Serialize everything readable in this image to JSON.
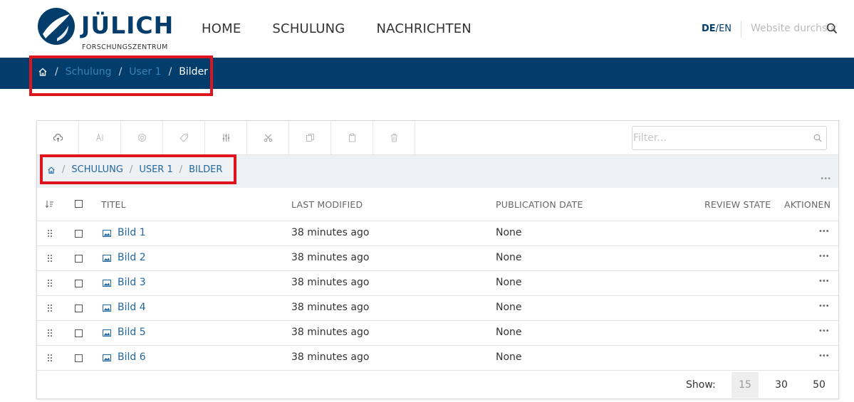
{
  "header": {
    "logo_word": "JÜLICH",
    "logo_sub": "FORSCHUNGSZENTRUM",
    "nav": [
      "HOME",
      "SCHULUNG",
      "NACHRICHTEN"
    ],
    "lang_active": "DE",
    "lang_sep": "/",
    "lang_other": "EN",
    "search_placeholder": "Website durchsuchen"
  },
  "breadcrumb": {
    "sep": "/",
    "items": [
      "Schulung",
      "User 1"
    ],
    "current": "Bilder"
  },
  "folder_contents": {
    "filter_placeholder": "Filter...",
    "path": {
      "sep": "/",
      "items": [
        "SCHULUNG",
        "USER 1",
        "BILDER"
      ]
    },
    "more": "•••",
    "columns": {
      "title": "TITEL",
      "modified": "LAST MODIFIED",
      "published": "PUBLICATION DATE",
      "review": "REVIEW STATE",
      "actions": "AKTIONEN"
    },
    "rows": [
      {
        "title": "Bild 1",
        "modified": "38 minutes ago",
        "published": "None",
        "actions": "•••"
      },
      {
        "title": "Bild 2",
        "modified": "38 minutes ago",
        "published": "None",
        "actions": "•••"
      },
      {
        "title": "Bild 3",
        "modified": "38 minutes ago",
        "published": "None",
        "actions": "•••"
      },
      {
        "title": "Bild 4",
        "modified": "38 minutes ago",
        "published": "None",
        "actions": "•••"
      },
      {
        "title": "Bild 5",
        "modified": "38 minutes ago",
        "published": "None",
        "actions": "•••"
      },
      {
        "title": "Bild 6",
        "modified": "38 minutes ago",
        "published": "None",
        "actions": "•••"
      }
    ],
    "pager": {
      "label": "Show:",
      "options": [
        "15",
        "30",
        "50"
      ],
      "active": "15"
    }
  },
  "colors": {
    "brand": "#023d6b",
    "link": "#23679e",
    "highlight": "#e0141e"
  },
  "icons": {
    "toolbar": [
      "upload-icon",
      "rename-icon",
      "workflow-icon",
      "tags-icon",
      "properties-icon",
      "cut-icon",
      "copy-icon",
      "paste-icon",
      "delete-icon"
    ]
  }
}
